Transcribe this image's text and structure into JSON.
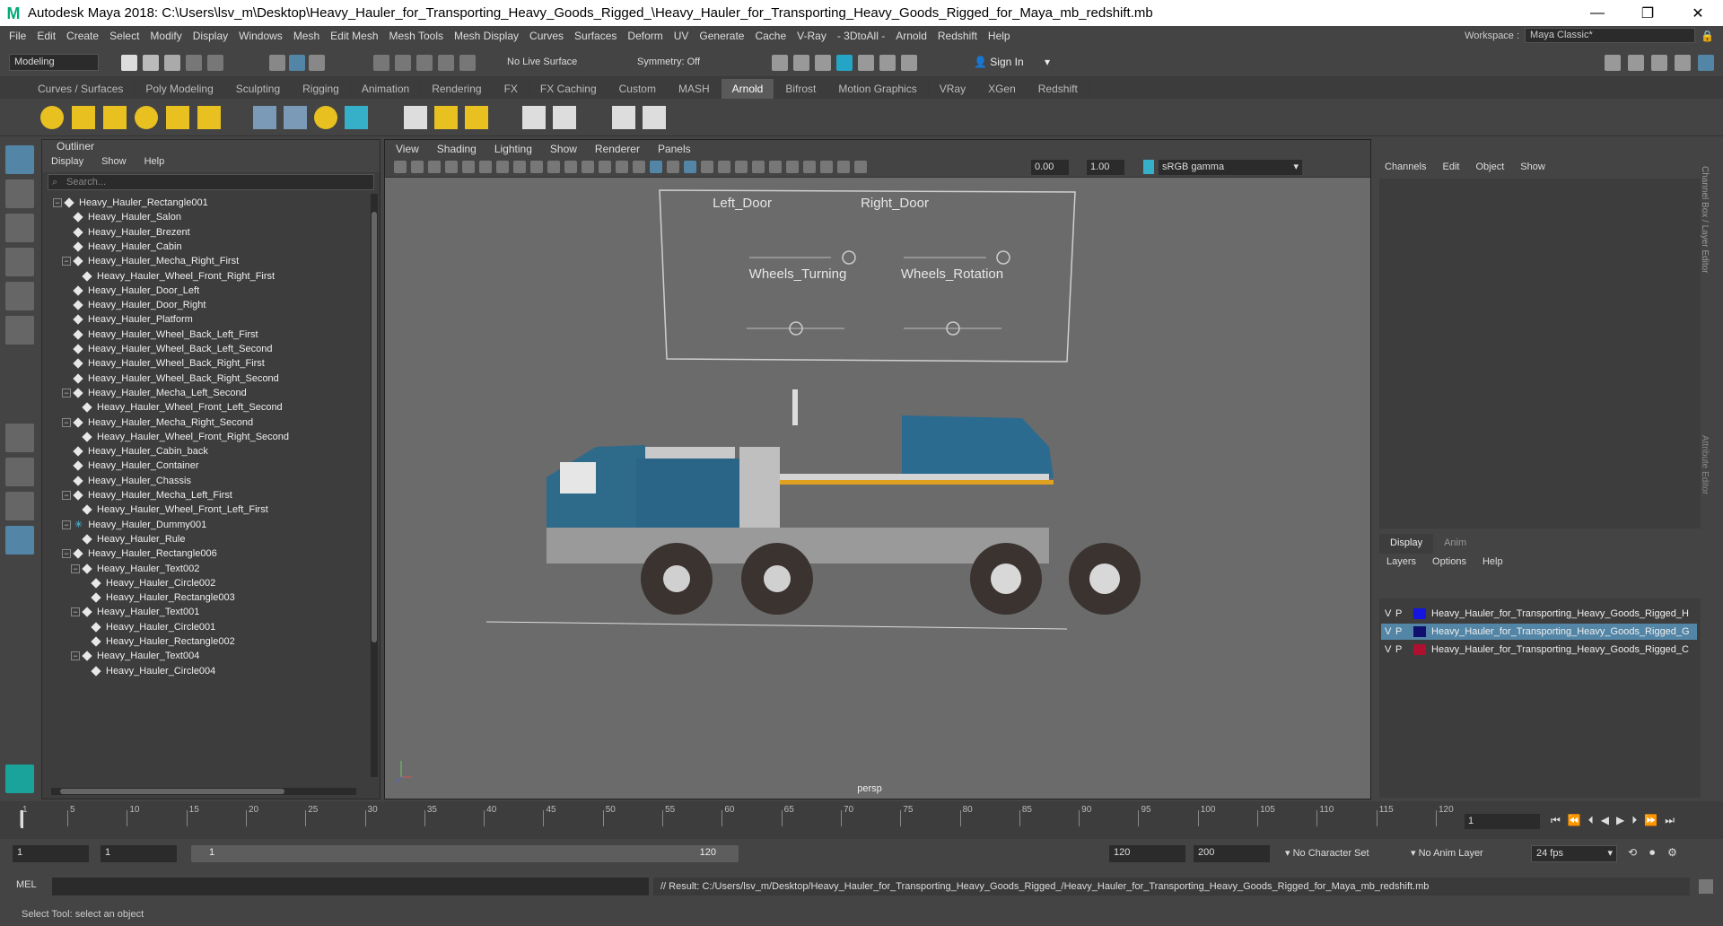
{
  "window": {
    "title": "Autodesk Maya 2018: C:\\Users\\lsv_m\\Desktop\\Heavy_Hauler_for_Transporting_Heavy_Goods_Rigged_\\Heavy_Hauler_for_Transporting_Heavy_Goods_Rigged_for_Maya_mb_redshift.mb",
    "minimize": "—",
    "restore": "❐",
    "close": "✕"
  },
  "menubar": [
    "File",
    "Edit",
    "Create",
    "Select",
    "Modify",
    "Display",
    "Windows",
    "Mesh",
    "Edit Mesh",
    "Mesh Tools",
    "Mesh Display",
    "Curves",
    "Surfaces",
    "Deform",
    "UV",
    "Generate",
    "Cache",
    "V-Ray",
    "- 3DtoAll -",
    "Arnold",
    "Redshift",
    "Help"
  ],
  "workspace": {
    "label": "Workspace :",
    "value": "Maya Classic*"
  },
  "statusline": {
    "mode": "Modeling",
    "live_surface": "No Live Surface",
    "symmetry": "Symmetry: Off",
    "sign_in": "Sign In"
  },
  "shelf_tabs": [
    "Curves / Surfaces",
    "Poly Modeling",
    "Sculpting",
    "Rigging",
    "Animation",
    "Rendering",
    "FX",
    "FX Caching",
    "Custom",
    "MASH",
    "Arnold",
    "Bifrost",
    "Motion Graphics",
    "VRay",
    "XGen",
    "Redshift"
  ],
  "shelf_active": "Arnold",
  "outliner": {
    "title": "Outliner",
    "menu": [
      "Display",
      "Show",
      "Help"
    ],
    "search_placeholder": "Search...",
    "items": [
      {
        "label": "Heavy_Hauler_Rectangle001",
        "depth": 0,
        "exp": "−"
      },
      {
        "label": "Heavy_Hauler_Salon",
        "depth": 1,
        "exp": ""
      },
      {
        "label": "Heavy_Hauler_Brezent",
        "depth": 1,
        "exp": ""
      },
      {
        "label": "Heavy_Hauler_Cabin",
        "depth": 1,
        "exp": ""
      },
      {
        "label": "Heavy_Hauler_Mecha_Right_First",
        "depth": 1,
        "exp": "−"
      },
      {
        "label": "Heavy_Hauler_Wheel_Front_Right_First",
        "depth": 2,
        "exp": ""
      },
      {
        "label": "Heavy_Hauler_Door_Left",
        "depth": 1,
        "exp": ""
      },
      {
        "label": "Heavy_Hauler_Door_Right",
        "depth": 1,
        "exp": ""
      },
      {
        "label": "Heavy_Hauler_Platform",
        "depth": 1,
        "exp": ""
      },
      {
        "label": "Heavy_Hauler_Wheel_Back_Left_First",
        "depth": 1,
        "exp": ""
      },
      {
        "label": "Heavy_Hauler_Wheel_Back_Left_Second",
        "depth": 1,
        "exp": ""
      },
      {
        "label": "Heavy_Hauler_Wheel_Back_Right_First",
        "depth": 1,
        "exp": ""
      },
      {
        "label": "Heavy_Hauler_Wheel_Back_Right_Second",
        "depth": 1,
        "exp": ""
      },
      {
        "label": "Heavy_Hauler_Mecha_Left_Second",
        "depth": 1,
        "exp": "−"
      },
      {
        "label": "Heavy_Hauler_Wheel_Front_Left_Second",
        "depth": 2,
        "exp": ""
      },
      {
        "label": "Heavy_Hauler_Mecha_Right_Second",
        "depth": 1,
        "exp": "−"
      },
      {
        "label": "Heavy_Hauler_Wheel_Front_Right_Second",
        "depth": 2,
        "exp": ""
      },
      {
        "label": "Heavy_Hauler_Cabin_back",
        "depth": 1,
        "exp": ""
      },
      {
        "label": "Heavy_Hauler_Container",
        "depth": 1,
        "exp": ""
      },
      {
        "label": "Heavy_Hauler_Chassis",
        "depth": 1,
        "exp": ""
      },
      {
        "label": "Heavy_Hauler_Mecha_Left_First",
        "depth": 1,
        "exp": "−"
      },
      {
        "label": "Heavy_Hauler_Wheel_Front_Left_First",
        "depth": 2,
        "exp": ""
      },
      {
        "label": "Heavy_Hauler_Dummy001",
        "depth": 1,
        "exp": "−",
        "icon": "locator"
      },
      {
        "label": "Heavy_Hauler_Rule",
        "depth": 2,
        "exp": ""
      },
      {
        "label": "Heavy_Hauler_Rectangle006",
        "depth": 1,
        "exp": "−"
      },
      {
        "label": "Heavy_Hauler_Text002",
        "depth": 2,
        "exp": "−"
      },
      {
        "label": "Heavy_Hauler_Circle002",
        "depth": 3,
        "exp": ""
      },
      {
        "label": "Heavy_Hauler_Rectangle003",
        "depth": 3,
        "exp": ""
      },
      {
        "label": "Heavy_Hauler_Text001",
        "depth": 2,
        "exp": "−"
      },
      {
        "label": "Heavy_Hauler_Circle001",
        "depth": 3,
        "exp": ""
      },
      {
        "label": "Heavy_Hauler_Rectangle002",
        "depth": 3,
        "exp": ""
      },
      {
        "label": "Heavy_Hauler_Text004",
        "depth": 2,
        "exp": "−"
      },
      {
        "label": "Heavy_Hauler_Circle004",
        "depth": 3,
        "exp": ""
      }
    ]
  },
  "viewport": {
    "menu": [
      "View",
      "Shading",
      "Lighting",
      "Show",
      "Renderer",
      "Panels"
    ],
    "exposure": "0.00",
    "gamma": "1.00",
    "colorspace": "sRGB gamma",
    "camera": "persp",
    "controls": {
      "left_door": "Left_Door",
      "right_door": "Right_Door",
      "wheels_turning": "Wheels_Turning",
      "wheels_rotation": "Wheels_Rotation"
    }
  },
  "channelbox": {
    "menu": [
      "Channels",
      "Edit",
      "Object",
      "Show"
    ],
    "side_tabs": [
      "Channel Box / Layer Editor",
      "Attribute Editor"
    ]
  },
  "layers": {
    "tabs": [
      "Display",
      "Anim"
    ],
    "menu": [
      "Layers",
      "Options",
      "Help"
    ],
    "rows": [
      {
        "v": "V",
        "p": "P",
        "color": "#1515e0",
        "name": "Heavy_Hauler_for_Transporting_Heavy_Goods_Rigged_H",
        "selected": false
      },
      {
        "v": "V",
        "p": "P",
        "color": "#101070",
        "name": "Heavy_Hauler_for_Transporting_Heavy_Goods_Rigged_G",
        "selected": true
      },
      {
        "v": "V",
        "p": "P",
        "color": "#b01030",
        "name": "Heavy_Hauler_for_Transporting_Heavy_Goods_Rigged_C",
        "selected": false
      }
    ]
  },
  "timeline": {
    "ticks": [
      "1",
      "5",
      "10",
      "15",
      "20",
      "25",
      "30",
      "35",
      "40",
      "45",
      "50",
      "55",
      "60",
      "65",
      "70",
      "75",
      "80",
      "85",
      "90",
      "95",
      "100",
      "105",
      "110",
      "115",
      "120"
    ],
    "current_frame": "1"
  },
  "range": {
    "start": "1",
    "start2": "1",
    "slider_start": "1",
    "slider_end": "120",
    "end": "120",
    "end2": "200",
    "character_set": "No Character Set",
    "anim_layer": "No Anim Layer",
    "fps": "24 fps"
  },
  "cmdline": {
    "lang": "MEL",
    "result": "// Result: C:/Users/lsv_m/Desktop/Heavy_Hauler_for_Transporting_Heavy_Goods_Rigged_/Heavy_Hauler_for_Transporting_Heavy_Goods_Rigged_for_Maya_mb_redshift.mb"
  },
  "helpline": {
    "text": "Select Tool: select an object"
  }
}
